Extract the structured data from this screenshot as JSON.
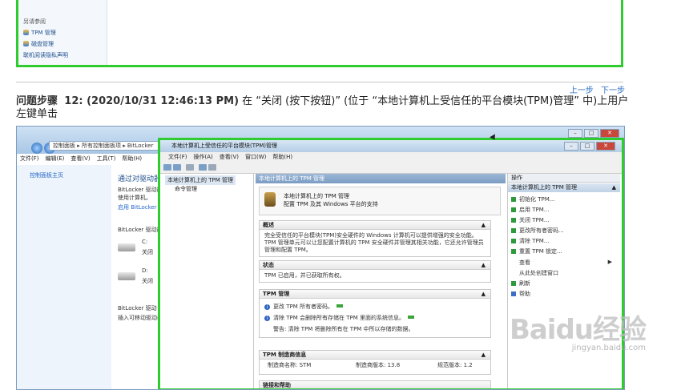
{
  "top_shot": {
    "items": [
      "另请参阅",
      "TPM 管理",
      "磁盘管理",
      "联机阅读隐私声明"
    ]
  },
  "nav": {
    "prev": "上一步",
    "next": "下一步"
  },
  "step": {
    "label": "问题步骤",
    "number_time": "12: (2020/10/31 12:46:13 PM)",
    "text": "在 “关闭 (按下按钮)” (位于 “本地计算机上受信任的平台模块(TPM)管理” 中)上用户左键单击"
  },
  "bg_window": {
    "address": "控制面板 ▸ 所有控制面板项 ▸ BitLocker",
    "menu": [
      "文件(F)",
      "编辑(E)",
      "查看(V)",
      "工具(T)",
      "帮助(H)"
    ],
    "side_home": "控制面板主页",
    "heading": "通过对驱动器",
    "desc1": "BitLocker 驱动器",
    "desc2": "使用计算机。",
    "link": "启用 BitLocker",
    "section1": "BitLocker 驱动器",
    "drive_c": "C:",
    "drive_c_state": "关闭",
    "drive_d": "D:",
    "drive_d_state": "关闭",
    "section2": "BitLocker 驱动",
    "section2_desc": "插入可移动驱动器"
  },
  "tpm": {
    "title": "本地计算机上受信任的平台模块(TPM)管理",
    "menu": [
      "文件(F)",
      "操作(A)",
      "查看(V)",
      "窗口(W)",
      "帮助(H)"
    ],
    "tree_root": "本地计算机上的 TPM 管理",
    "tree_child": "命令管理",
    "center_head": "本地计算机上的 TPM 管理",
    "intro_title": "本地计算机上的 TPM 管理",
    "intro_sub": "配置 TPM 及其 Windows 平台的支持",
    "overview_h": "概述",
    "overview_b": "完全受信任的平台模块(TPM)安全硬件的 Windows 计算机可以提供增强的安全功能。TPM 管理单元可以让您配置计算机的 TPM 安全硬件并管理其相关功能，它还允许管理员管理和配置 TPM。",
    "status_h": "状态",
    "status_b": "TPM 已启用，并已获取所有权。",
    "mgmt_h": "TPM 管理",
    "mgmt_1": "更改 TPM 所有者密码。",
    "mgmt_2": "清除 TPM 会删除所有存储在 TPM 里面的系统信息。",
    "mgmt_3": "警告: 清除 TPM 将删除所有在 TPM 中所以存储的数据。",
    "vendor_h": "TPM 制造商信息",
    "vendor_name": "制造商名称: STM",
    "vendor_ver": "制造商版本: 13.8",
    "vendor_spec": "规范版本: 1.2",
    "cut_h": "链接和帮助",
    "actions_h": "操作",
    "actions_sub": "本地计算机上的 TPM 管理",
    "actions": [
      "初始化 TPM...",
      "启用 TPM...",
      "关闭 TPM...",
      "更改所有者密码...",
      "清除 TPM...",
      "重置 TPM 锁定...",
      "查看",
      "从此处创建窗口",
      "刷新",
      "帮助"
    ]
  },
  "watermark": {
    "logo": "Baidu经验",
    "url": "jingyan.baidu.com"
  }
}
